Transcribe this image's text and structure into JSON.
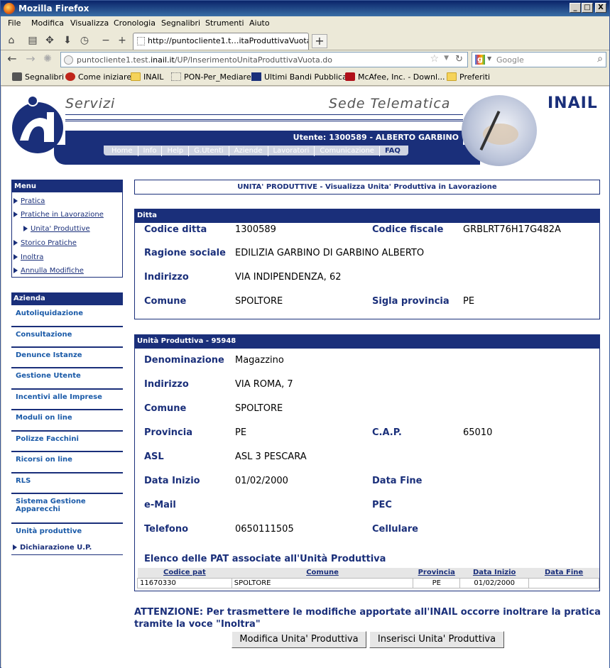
{
  "window": {
    "title": "Mozilla Firefox",
    "controls": [
      "_",
      "□",
      "X"
    ]
  },
  "menubar": [
    "File",
    "Modifica",
    "Visualizza",
    "Cronologia",
    "Segnalibri",
    "Strumenti",
    "Aiuto"
  ],
  "tab": {
    "title": "http://puntocliente1.t…itaProduttivaVuota.do"
  },
  "urlbar": {
    "prefix": "puntocliente1.test.",
    "domain": "inail.it",
    "path": "/UP/InserimentoUnitaProduttivaVuota.do"
  },
  "search": {
    "placeholder": "Google"
  },
  "bookmarks": [
    "Segnalibri",
    "Come iniziare",
    "INAIL",
    "PON-Per_Mediare",
    "Ultimi Bandi Pubblicati",
    "McAfee, Inc. - Downl...",
    "Preferiti"
  ],
  "header": {
    "servizi": "Servizi",
    "sede": "Sede Telematica",
    "brand": "INAIL",
    "user": "Utente: 1300589 - ALBERTO GARBINO",
    "nav": [
      "Home",
      "Info",
      "Help",
      "G.Utenti",
      "Aziende",
      "Lavoratori",
      "Comunicazione",
      "FAQ"
    ]
  },
  "sidebar": {
    "menu_title": "Menu",
    "menu_items": [
      "Pratica",
      "Pratiche in Lavorazione",
      "Unita' Produttive",
      "Storico Pratiche",
      "Inoltra",
      "Annulla Modifiche"
    ],
    "azienda_title": "Azienda",
    "azienda_items": [
      "Autoliquidazione",
      "Consultazione",
      "Denunce Istanze",
      "Gestione Utente",
      "Incentivi alle Imprese",
      "Moduli on line",
      "Polizze Facchini",
      "Ricorsi on line",
      "RLS",
      "Sistema Gestione Apparecchi",
      "Unità produttive",
      "Dichiarazione U.P."
    ]
  },
  "page_title": "UNITA' PRODUTTIVE - Visualizza Unita' Produttiva in Lavorazione",
  "ditta": {
    "title": "Ditta",
    "codice_ditta_label": "Codice ditta",
    "codice_ditta": "1300589",
    "codice_fiscale_label": "Codice fiscale",
    "codice_fiscale": "GRBLRT76H17G482A",
    "ragione_label": "Ragione sociale",
    "ragione": "EDILIZIA GARBINO DI GARBINO ALBERTO",
    "indirizzo_label": "Indirizzo",
    "indirizzo": "VIA INDIPENDENZA, 62",
    "comune_label": "Comune",
    "comune": "SPOLTORE",
    "sigla_label": "Sigla provincia",
    "sigla": "PE"
  },
  "unita": {
    "title": "Unità Produttiva - 95948",
    "denominazione_label": "Denominazione",
    "denominazione": "Magazzino",
    "indirizzo_label": "Indirizzo",
    "indirizzo": "VIA ROMA, 7",
    "comune_label": "Comune",
    "comune": "SPOLTORE",
    "provincia_label": "Provincia",
    "provincia": "PE",
    "cap_label": "C.A.P.",
    "cap": "65010",
    "asl_label": "ASL",
    "asl": "ASL 3 PESCARA",
    "data_inizio_label": "Data Inizio",
    "data_inizio": "01/02/2000",
    "data_fine_label": "Data Fine",
    "data_fine": "",
    "email_label": "e-Mail",
    "email": "",
    "pec_label": "PEC",
    "pec": "",
    "telefono_label": "Telefono",
    "telefono": "0650111505",
    "cellulare_label": "Cellulare",
    "cellulare": "",
    "pat_title": "Elenco delle PAT associate all'Unità Produttiva",
    "pat_columns": [
      "Codice pat",
      "Comune",
      "Provincia",
      "Data Inizio",
      "Data Fine"
    ],
    "pat_rows": [
      [
        "11670330",
        "SPOLTORE",
        "PE",
        "01/02/2000",
        ""
      ]
    ]
  },
  "attenzione": "ATTENZIONE: Per trasmettere le modifiche apportate all'INAIL occorre inoltrare la pratica tramite la voce \"Inoltra\"",
  "buttons": {
    "modifica": "Modifica Unita' Produttiva",
    "inserisci": "Inserisci Unita' Produttiva"
  }
}
